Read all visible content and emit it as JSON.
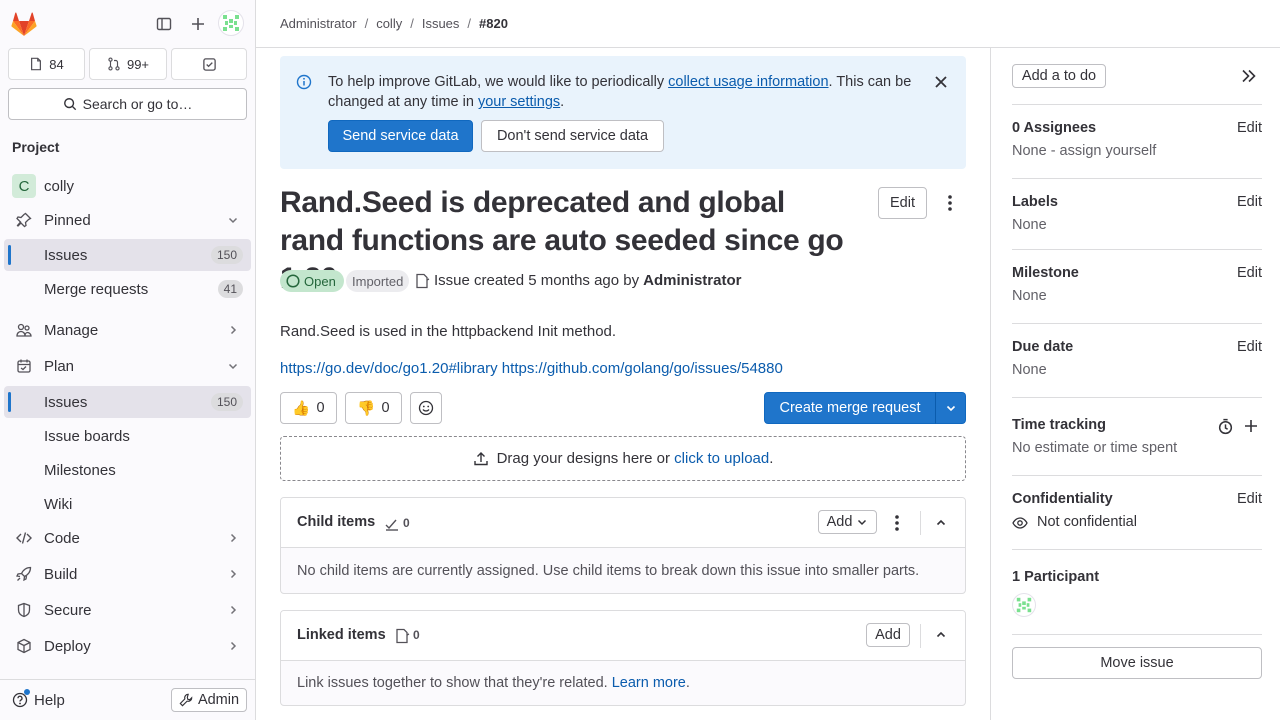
{
  "sidebar": {
    "counters": {
      "issues": "84",
      "merge_requests": "99+"
    },
    "search_label": "Search or go to…",
    "section_title": "Project",
    "project": {
      "avatar_letter": "C",
      "name": "colly"
    },
    "pinned": {
      "label": "Pinned",
      "items": [
        {
          "label": "Issues",
          "count": "150"
        },
        {
          "label": "Merge requests",
          "count": "41"
        }
      ]
    },
    "manage_label": "Manage",
    "plan": {
      "label": "Plan",
      "items": [
        {
          "label": "Issues",
          "count": "150"
        },
        {
          "label": "Issue boards"
        },
        {
          "label": "Milestones"
        },
        {
          "label": "Wiki"
        }
      ]
    },
    "groups": [
      "Code",
      "Build",
      "Secure",
      "Deploy"
    ],
    "help_label": "Help",
    "admin_label": "Admin"
  },
  "breadcrumb": [
    "Administrator",
    "colly",
    "Issues",
    "#820"
  ],
  "banner": {
    "text_before": "To help improve GitLab, we would like to periodically ",
    "link1": "collect usage information",
    "text_middle": ". This can be changed at any time in ",
    "link2": "your settings",
    "text_after": ".",
    "send_button": "Send service data",
    "dont_send_button": "Don't send service data"
  },
  "issue": {
    "title": "Rand.Seed is deprecated and global rand functions are auto seeded since go 1.20",
    "edit_label": "Edit",
    "status": "Open",
    "imported_badge": "Imported",
    "created_text": "Issue created 5 months ago by",
    "author": "Administrator",
    "description": "Rand.Seed is used in the httpbackend Init method.",
    "links": "https://go.dev/doc/go1.20#library https://github.com/golang/go/issues/54880",
    "thumbs_up": {
      "emoji": "👍",
      "count": "0"
    },
    "thumbs_down": {
      "emoji": "👎",
      "count": "0"
    },
    "create_mr_label": "Create merge request",
    "upload_text": "Drag your designs here or ",
    "upload_link": "click to upload",
    "upload_suffix": "."
  },
  "child_items": {
    "title": "Child items",
    "count": "0",
    "add_label": "Add",
    "empty_text": "No child items are currently assigned. Use child items to break down this issue into smaller parts."
  },
  "linked_items": {
    "title": "Linked items",
    "count": "0",
    "add_label": "Add",
    "empty_text": "Link issues together to show that they're related. ",
    "learn_more": "Learn more",
    "suffix": "."
  },
  "right_sidebar": {
    "todo_label": "Add a to do",
    "assignees": {
      "title": "0 Assignees",
      "edit": "Edit",
      "value": "None - assign yourself"
    },
    "labels": {
      "title": "Labels",
      "edit": "Edit",
      "value": "None"
    },
    "milestone": {
      "title": "Milestone",
      "edit": "Edit",
      "value": "None"
    },
    "due_date": {
      "title": "Due date",
      "edit": "Edit",
      "value": "None"
    },
    "time_tracking": {
      "title": "Time tracking",
      "value": "No estimate or time spent"
    },
    "confidentiality": {
      "title": "Confidentiality",
      "edit": "Edit",
      "value": "Not confidential"
    },
    "participants": {
      "title": "1 Participant"
    },
    "move_label": "Move issue"
  },
  "colors": {
    "primary": "#1f75cb",
    "link": "#0b5cad",
    "open_badge": "#c3e6cd",
    "banner_bg": "#e9f3fc"
  }
}
